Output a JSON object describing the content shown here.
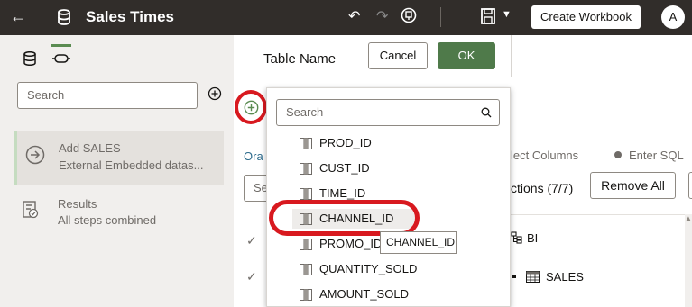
{
  "topbar": {
    "title": "Sales Times",
    "create_button": "Create Workbook",
    "avatar_initial": "A",
    "icons": [
      "back-arrow-icon",
      "database-icon",
      "undo-icon",
      "redo-icon",
      "notes-icon",
      "save-icon",
      "chevron-down-icon"
    ]
  },
  "left_panel": {
    "search_placeholder": "Search",
    "steps": [
      {
        "title": "Add SALES",
        "subtitle": "External Embedded datas..."
      },
      {
        "title": "Results",
        "subtitle": "All steps combined"
      }
    ]
  },
  "header": {
    "table_name_label": "Table Name",
    "cancel_label": "Cancel",
    "ok_label": "OK"
  },
  "background": {
    "ora_text": "Ora",
    "search_fragment": "Se",
    "select_columns": "lect Columns",
    "enter_sql": "Enter SQL",
    "sections_text": "ctions (7/7)",
    "remove_all": "Remove All",
    "tree": {
      "schema": "BI",
      "table": "SALES"
    }
  },
  "dropdown": {
    "search_placeholder": "Search",
    "columns": [
      "PROD_ID",
      "CUST_ID",
      "TIME_ID",
      "CHANNEL_ID",
      "PROMO_ID",
      "QUANTITY_SOLD",
      "AMOUNT_SOLD"
    ],
    "highlighted": "CHANNEL_ID",
    "tooltip": "CHANNEL_ID"
  },
  "colors": {
    "topbar_bg": "#312d2a",
    "ok_green": "#4f7a4a",
    "annotation_red": "#d8191f"
  }
}
